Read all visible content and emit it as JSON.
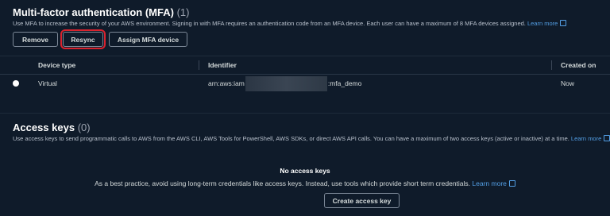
{
  "mfa": {
    "title": "Multi-factor authentication (MFA)",
    "count": "(1)",
    "description": "Use MFA to increase the security of your AWS environment. Signing in with MFA requires an authentication code from an MFA device. Each user can have a maximum of 8 MFA devices assigned.",
    "learn_more": "Learn more",
    "buttons": {
      "remove": "Remove",
      "resync": "Resync",
      "assign": "Assign MFA device"
    },
    "columns": {
      "device_type": "Device type",
      "identifier": "Identifier",
      "created_on": "Created on"
    },
    "rows": [
      {
        "device_type": "Virtual",
        "identifier_prefix": "arn:aws:iam",
        "identifier_suffix": ":mfa_demo",
        "created_on": "Now"
      }
    ]
  },
  "access_keys": {
    "title": "Access keys",
    "count": "(0)",
    "description": "Use access keys to send programmatic calls to AWS from the AWS CLI, AWS Tools for PowerShell, AWS SDKs, or direct AWS API calls. You can have a maximum of two access keys (active or inactive) at a time.",
    "learn_more": "Learn more",
    "empty_title": "No access keys",
    "empty_description": "As a best practice, avoid using long-term credentials like access keys. Instead, use tools which provide short term credentials.",
    "empty_learn_more": "Learn more",
    "create_button": "Create access key"
  },
  "colors": {
    "background": "#0f1b2a",
    "link": "#539fe5",
    "highlight": "#d9232e"
  }
}
